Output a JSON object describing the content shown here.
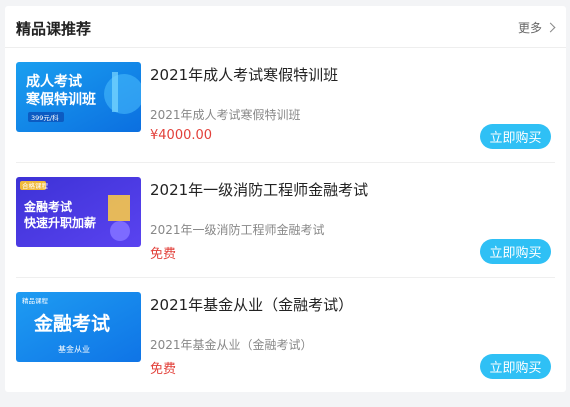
{
  "header": {
    "title": "精品课推荐",
    "more_label": "更多"
  },
  "courses": [
    {
      "title": "2021年成人考试寒假特训班",
      "subtitle": "2021年成人考试寒假特训班",
      "price": "¥4000.00",
      "buy_label": "立即购买",
      "thumb_lines": [
        "成人考试",
        "寒假特训班",
        "399元/科"
      ]
    },
    {
      "title": "2021年一级消防工程师金融考试",
      "subtitle": "2021年一级消防工程师金融考试",
      "price": "免费",
      "buy_label": "立即购买",
      "thumb_lines": [
        "金融考试",
        "快速升职加薪",
        "合格课程"
      ]
    },
    {
      "title": "2021年基金从业（金融考试）",
      "subtitle": "2021年基金从业（金融考试）",
      "price": "免费",
      "buy_label": "立即购买",
      "thumb_lines": [
        "金融考试",
        "基金从业",
        "精品课程"
      ]
    }
  ],
  "colors": {
    "accent": "#2fc0f5",
    "price": "#e2403a"
  }
}
